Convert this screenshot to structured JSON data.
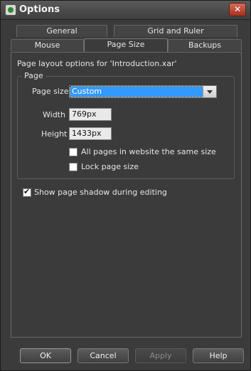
{
  "window": {
    "title": "Options"
  },
  "tabs": {
    "row_back": [
      "General",
      "Grid and Ruler"
    ],
    "row_front": [
      "Mouse",
      "Page Size",
      "Backups"
    ],
    "active": "Page Size"
  },
  "page_size_panel": {
    "heading": "Page layout options for 'Introduction.xar'",
    "group_label": "Page",
    "page_size_label": "Page size",
    "page_size_value": "Custom",
    "width_label": "Width",
    "width_value": "769px",
    "height_label": "Height",
    "height_value": "1433px",
    "same_size_label": "All pages in website the same size",
    "same_size_checked": false,
    "lock_label": "Lock page size",
    "lock_checked": false,
    "shadow_label": "Show page shadow during editing",
    "shadow_checked": true
  },
  "buttons": {
    "ok": "OK",
    "cancel": "Cancel",
    "apply": "Apply",
    "help": "Help"
  },
  "icons": {
    "app": "app-icon",
    "close": "close-icon",
    "dropdown": "chevron-down-icon"
  }
}
